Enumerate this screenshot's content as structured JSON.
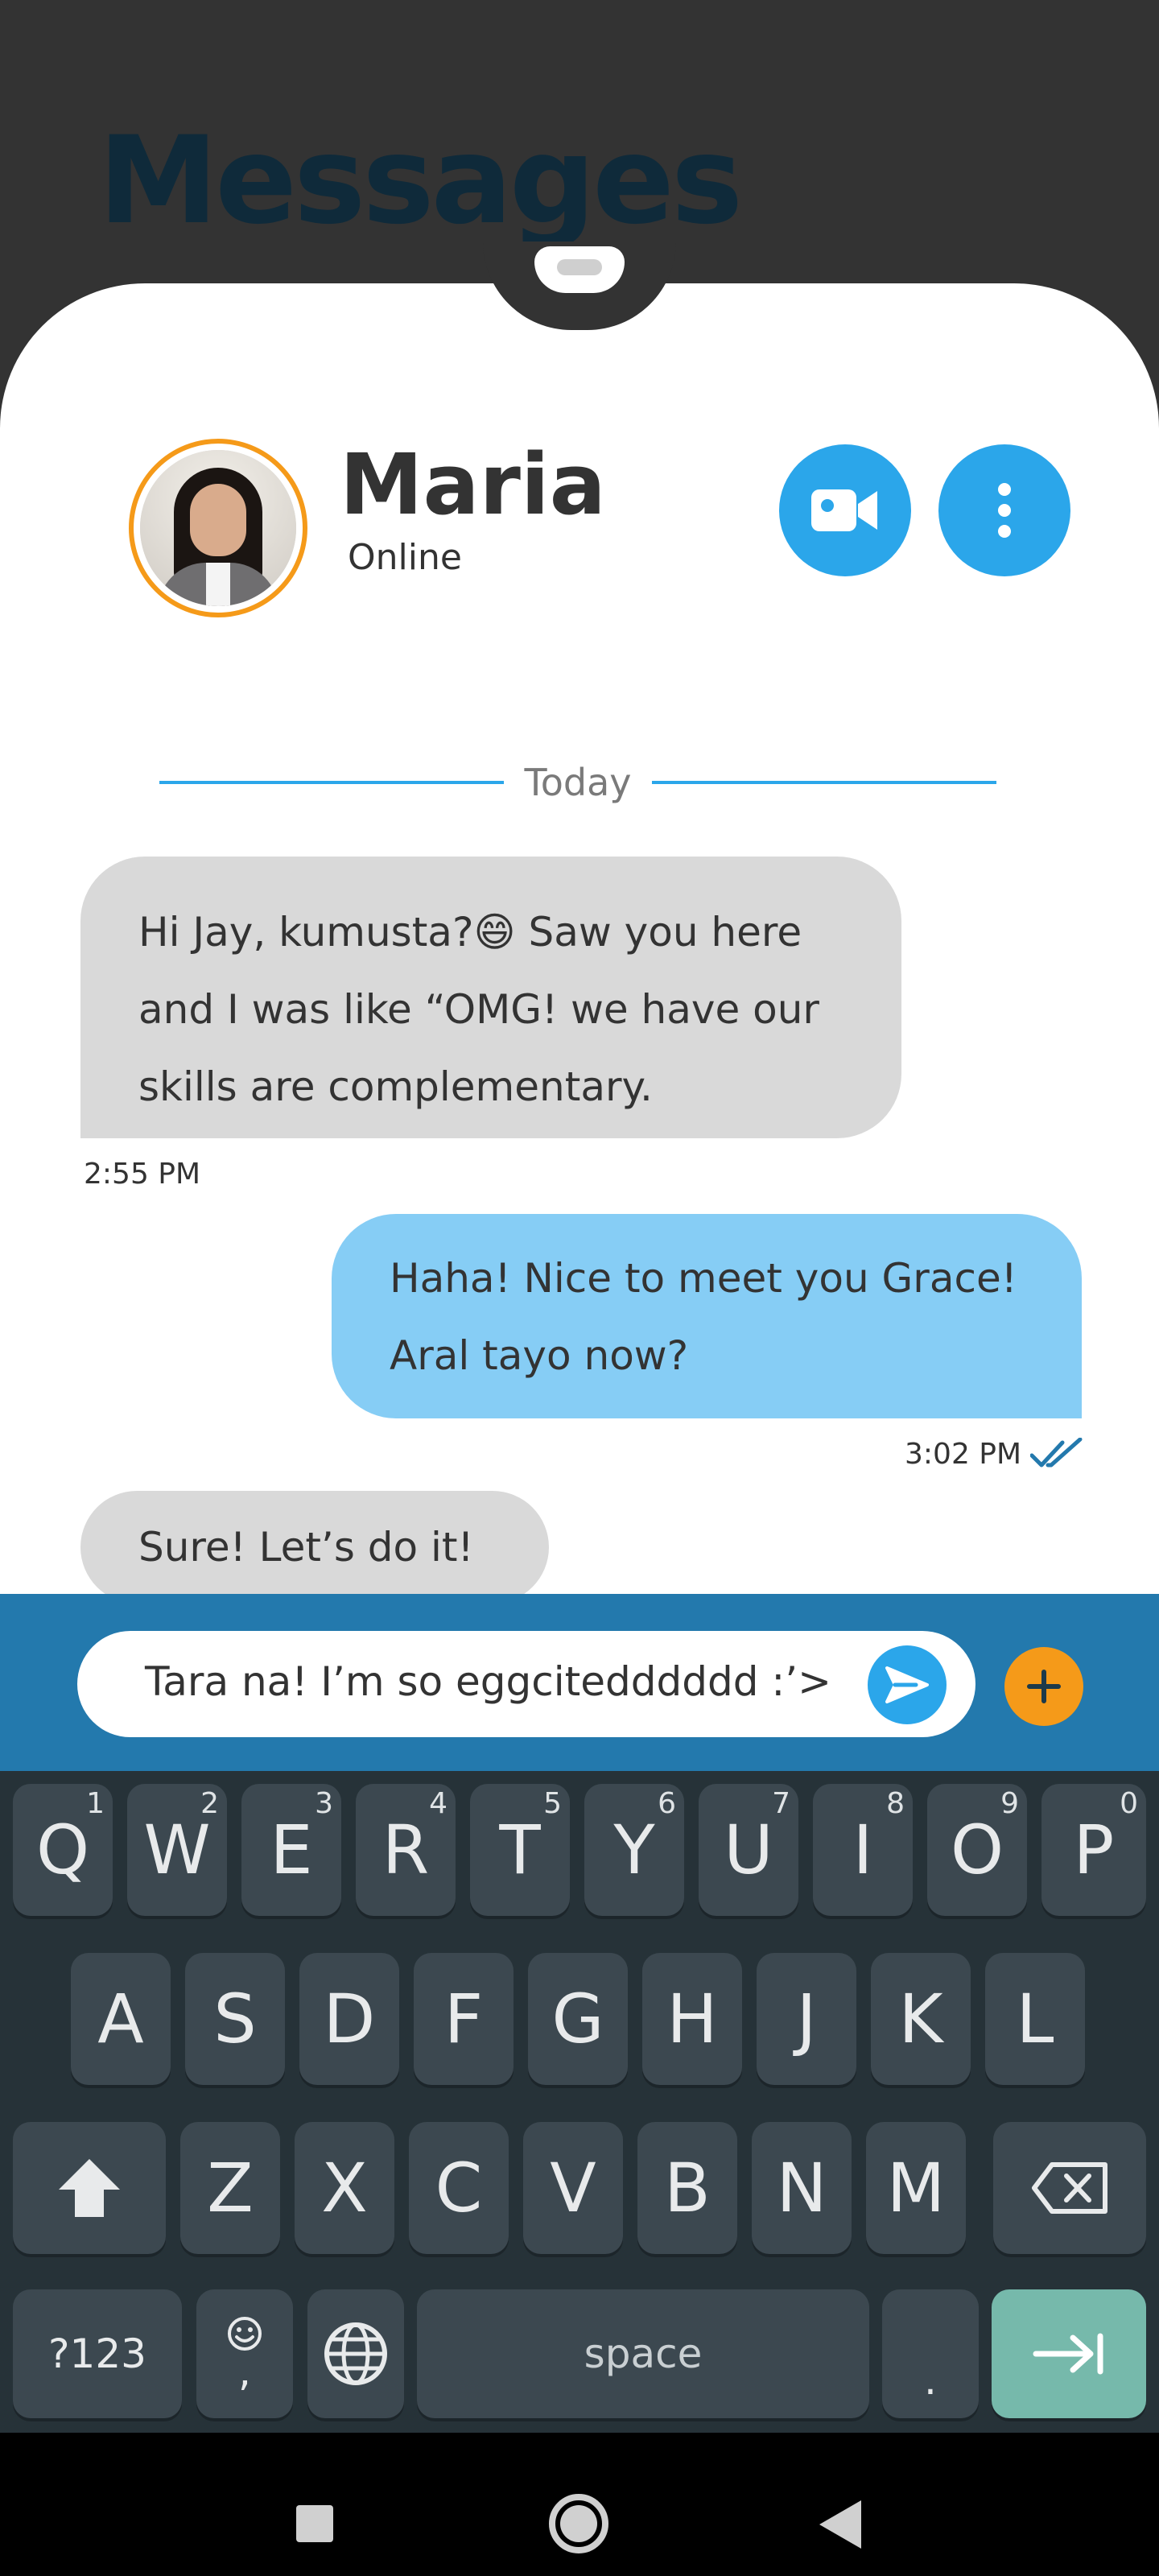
{
  "page": {
    "title": "Messages"
  },
  "contact": {
    "name": "Maria",
    "status": "Online"
  },
  "chat": {
    "date_label": "Today",
    "messages": [
      {
        "direction": "incoming",
        "lines": [
          "Hi Jay, kumusta?😄  Saw you here",
          "and I was like “OMG! we have our",
          "skills are complementary."
        ],
        "time": "2:55 PM"
      },
      {
        "direction": "outgoing",
        "lines": [
          "Haha! Nice to meet you Grace!",
          "Aral tayo now?"
        ],
        "time": "3:02 PM",
        "read": true
      },
      {
        "direction": "incoming",
        "lines": [
          "Sure! Let’s do it! :)"
        ]
      }
    ]
  },
  "composer": {
    "value": "Tara na! I’m so eggcitedddddd :’>"
  },
  "keyboard": {
    "row1": [
      {
        "key": "Q",
        "hint": "1"
      },
      {
        "key": "W",
        "hint": "2"
      },
      {
        "key": "E",
        "hint": "3"
      },
      {
        "key": "R",
        "hint": "4"
      },
      {
        "key": "T",
        "hint": "5"
      },
      {
        "key": "Y",
        "hint": "6"
      },
      {
        "key": "U",
        "hint": "7"
      },
      {
        "key": "I",
        "hint": "8"
      },
      {
        "key": "O",
        "hint": "9"
      },
      {
        "key": "P",
        "hint": "0"
      }
    ],
    "row2": [
      "A",
      "S",
      "D",
      "F",
      "G",
      "H",
      "J",
      "K",
      "L"
    ],
    "row3": [
      "Z",
      "X",
      "C",
      "V",
      "B",
      "N",
      "M"
    ],
    "symbols_label": "?123",
    "comma_label": ",",
    "space_label": "space",
    "period_label": "."
  },
  "colors": {
    "accent_blue": "#2BA6EA",
    "outgoing_bubble": "#86CDF5",
    "incoming_bubble": "#D9D9D9",
    "composer_bar": "#2379AD",
    "avatar_ring": "#F59A19",
    "enter_key": "#76B9AB"
  },
  "icons": {
    "video": "video-camera-icon",
    "more": "more-vertical-icon",
    "send": "send-icon",
    "add": "plus-icon",
    "read": "double-check-icon",
    "shift": "shift-arrow-icon",
    "backspace": "backspace-icon",
    "emoji": "emoji-icon",
    "language": "globe-icon",
    "enter": "tab-arrow-icon"
  }
}
